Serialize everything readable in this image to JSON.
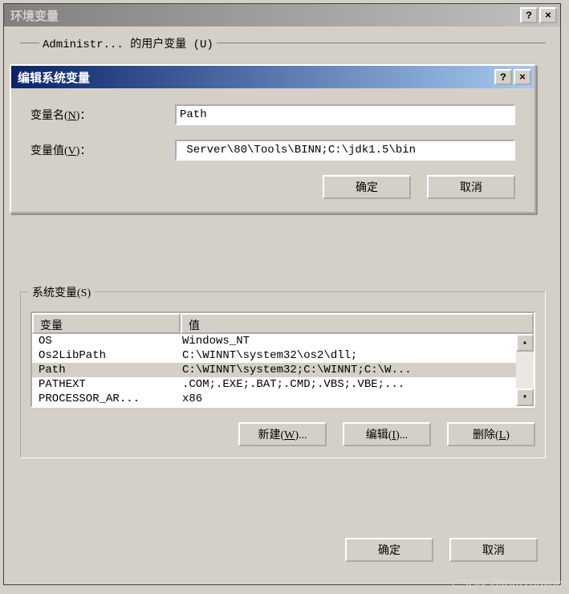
{
  "outer": {
    "title": "环境变量",
    "help": "?",
    "close": "×",
    "user_group_partial": "的用户变量"
  },
  "edit_dialog": {
    "title": "编辑系统变量",
    "name_label": "变量名(N)：",
    "value_label": "变量值(V)：",
    "name_value": "Path",
    "value_value": " Server\\80\\Tools\\BINN;C:\\jdk1.5\\bin",
    "ok": "确定",
    "cancel": "取消"
  },
  "sys_group": {
    "label": "系统变量(S)",
    "col_var": "变量",
    "col_val": "值",
    "rows": [
      {
        "var": "OS",
        "val": "Windows_NT",
        "selected": false
      },
      {
        "var": "Os2LibPath",
        "val": "C:\\WINNT\\system32\\os2\\dll;",
        "selected": false
      },
      {
        "var": "Path",
        "val": "C:\\WINNT\\system32;C:\\WINNT;C:\\W...",
        "selected": true
      },
      {
        "var": "PATHEXT",
        "val": ".COM;.EXE;.BAT;.CMD;.VBS;.VBE;...",
        "selected": false
      },
      {
        "var": "PROCESSOR_AR...",
        "val": "x86",
        "selected": false
      }
    ],
    "new_btn": "新建(W)...",
    "edit_btn": "编辑(I)...",
    "delete_btn": "删除(L)"
  },
  "footer": {
    "ok": "确定",
    "cancel": "取消"
  },
  "watermark": "CSDN @KimYuhyun"
}
